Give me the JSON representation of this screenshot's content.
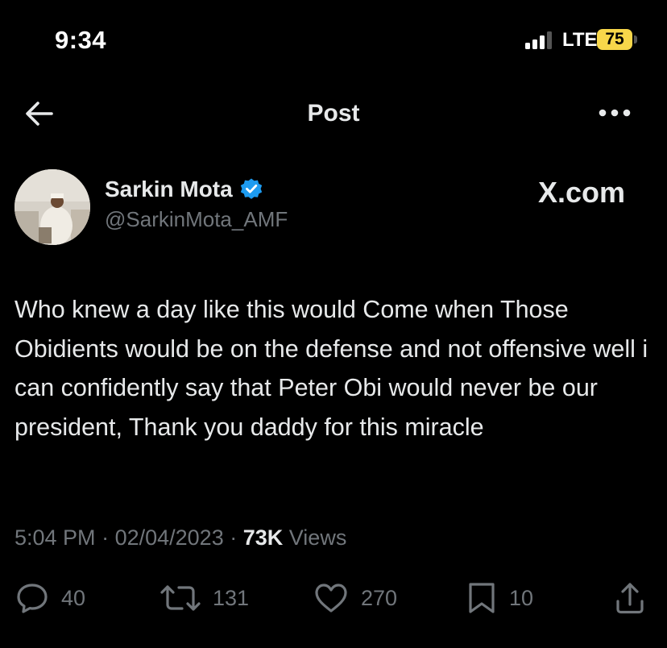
{
  "status_bar": {
    "time": "9:34",
    "network": "LTE",
    "battery": "75"
  },
  "nav": {
    "title": "Post",
    "back_icon": "arrow-left-icon",
    "more_icon": "more-horizontal-icon"
  },
  "post": {
    "author_name": "Sarkin Mota",
    "author_handle": "@SarkinMota_AMF",
    "watermark": "X.com",
    "text": "Who knew a day like this would Come when Those Obidients would be on the defense and not offensive well i can confidently say that Peter Obi would never be our president, Thank you daddy for this miracle",
    "time": "5:04 PM",
    "date": "02/04/2023",
    "views_count": "73K",
    "views_label": "Views"
  },
  "actions": {
    "replies": "40",
    "reposts": "131",
    "likes": "270",
    "bookmarks": "10"
  },
  "colors": {
    "background": "#000000",
    "text": "#e7e9ea",
    "secondary": "#71767b",
    "verified": "#1d9bf0",
    "battery": "#f8d74a"
  }
}
